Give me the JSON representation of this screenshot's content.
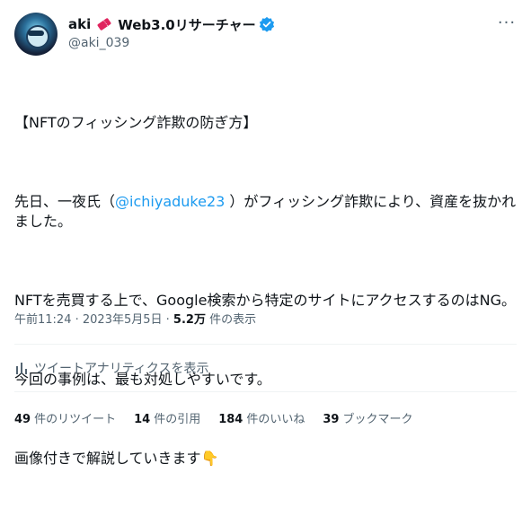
{
  "author": {
    "display_name": "aki",
    "title_suffix": "Web3.0リサーチャー",
    "handle": "@aki_039"
  },
  "tweet": {
    "heading": "【NFTのフィッシング詐欺の防ぎ方】",
    "p2_before": "先日、一夜氏（",
    "p2_mention": "@ichiyaduke23",
    "p2_after": " ）がフィッシング詐欺により、資産を抜かれました。",
    "p3": "NFTを売買する上で、Google検索から特定のサイトにアクセスするのはNG。",
    "p4": "今回の事例は、最も対処しやすいです。",
    "p5": "画像付きで解説していきます👇"
  },
  "meta": {
    "time": "午前11:24",
    "date": "2023年5月5日",
    "views": "5.2万",
    "views_label": "件の表示"
  },
  "analytics": {
    "label": "ツイートアナリティクスを表示"
  },
  "stats": [
    {
      "value": "49",
      "label": "件のリツイート"
    },
    {
      "value": "14",
      "label": "件の引用"
    },
    {
      "value": "184",
      "label": "件のいいね"
    },
    {
      "value": "39",
      "label": "ブックマーク"
    }
  ],
  "colors": {
    "link": "#1d9bf0",
    "verified": "#1d9bf0",
    "muted": "#536471"
  }
}
